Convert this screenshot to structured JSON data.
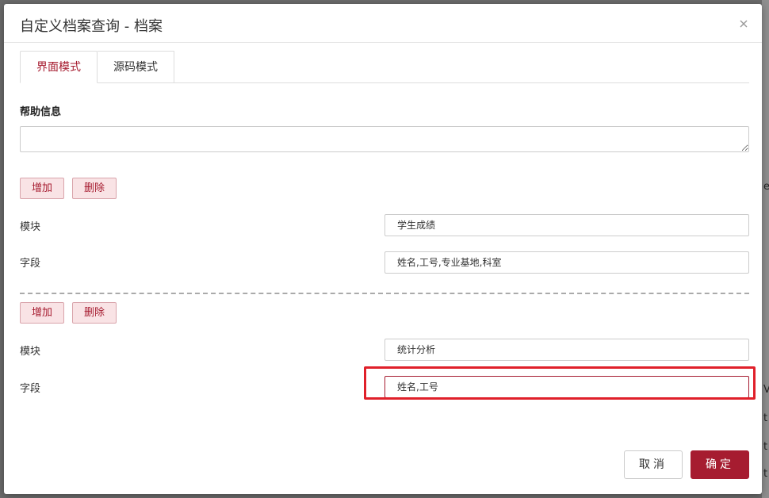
{
  "modal": {
    "title": "自定义档案查询 - 档案",
    "tabs": [
      {
        "label": "界面模式",
        "active": true
      },
      {
        "label": "源码模式",
        "active": false
      }
    ],
    "help": {
      "label": "帮助信息",
      "value": ""
    },
    "sections": [
      {
        "add_label": "增加",
        "delete_label": "删除",
        "module_label": "模块",
        "module_value": "学生成绩",
        "fields_label": "字段",
        "fields_value": "姓名,工号,专业基地,科室"
      },
      {
        "add_label": "增加",
        "delete_label": "删除",
        "module_label": "模块",
        "module_value": "统计分析",
        "fields_label": "字段",
        "fields_value": "姓名,工号"
      }
    ],
    "footer": {
      "cancel_label": "取消",
      "ok_label": "确定"
    }
  },
  "colors": {
    "accent": "#a61c30",
    "highlight": "#e0202a"
  },
  "background": {
    "clipped_glyphs": [
      "e",
      "V",
      "t",
      "t",
      "t"
    ]
  }
}
